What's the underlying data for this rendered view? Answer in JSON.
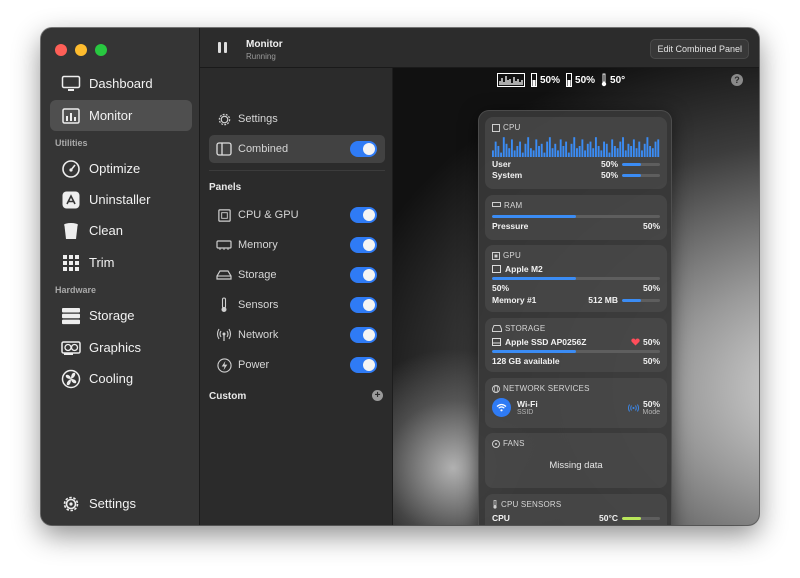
{
  "sidebar": {
    "items": [
      {
        "label": "Dashboard",
        "icon": "monitor-icon"
      },
      {
        "label": "Monitor",
        "icon": "chart-icon",
        "active": true
      }
    ],
    "utilities_label": "Utilities",
    "utilities": [
      {
        "label": "Optimize",
        "icon": "gauge-icon"
      },
      {
        "label": "Uninstaller",
        "icon": "app-store-icon"
      },
      {
        "label": "Clean",
        "icon": "trash-can-icon"
      },
      {
        "label": "Trim",
        "icon": "grid-icon"
      }
    ],
    "hardware_label": "Hardware",
    "hardware": [
      {
        "label": "Storage",
        "icon": "drive-stack-icon"
      },
      {
        "label": "Graphics",
        "icon": "gpu-card-icon"
      },
      {
        "label": "Cooling",
        "icon": "fan-icon"
      }
    ],
    "settings_label": "Settings"
  },
  "topbar": {
    "title": "Monitor",
    "status": "Running",
    "edit_button": "Edit Combined Panel"
  },
  "menu": {
    "settings": "Settings",
    "combined": "Combined",
    "panels_heading": "Panels",
    "panels": [
      {
        "label": "CPU & GPU",
        "icon": "chip-icon"
      },
      {
        "label": "Memory",
        "icon": "memory-icon"
      },
      {
        "label": "Storage",
        "icon": "drive-icon"
      },
      {
        "label": "Sensors",
        "icon": "thermometer-icon"
      },
      {
        "label": "Network",
        "icon": "antenna-icon"
      },
      {
        "label": "Power",
        "icon": "bolt-icon"
      }
    ],
    "custom_heading": "Custom"
  },
  "statusbar": {
    "mem": "50%",
    "disk": "50%",
    "temp": "50°"
  },
  "panel": {
    "cpu": {
      "title": "CPU",
      "user_label": "User",
      "user_value": "50%",
      "user_level": 0.5,
      "system_label": "System",
      "system_value": "50%",
      "system_level": 0.5,
      "graph": [
        0.3,
        0.7,
        0.5,
        0.2,
        0.9,
        0.6,
        0.4,
        0.8,
        0.3,
        0.5,
        0.7,
        0.2,
        0.6,
        0.9,
        0.4,
        0.3,
        0.8,
        0.5,
        0.6,
        0.2,
        0.7,
        0.9,
        0.4,
        0.6,
        0.3,
        0.8,
        0.5,
        0.7,
        0.2,
        0.6,
        0.9,
        0.4,
        0.5,
        0.8,
        0.3,
        0.6,
        0.7,
        0.4,
        0.9,
        0.5,
        0.3,
        0.7,
        0.6,
        0.2,
        0.8,
        0.5,
        0.4,
        0.7,
        0.9,
        0.3,
        0.6,
        0.5,
        0.8,
        0.4,
        0.7,
        0.3,
        0.6,
        0.9,
        0.5,
        0.4,
        0.7,
        0.8
      ]
    },
    "ram": {
      "title": "RAM",
      "pressure_label": "Pressure",
      "pressure_value": "50%",
      "level": 0.5
    },
    "gpu": {
      "title": "GPU",
      "name": "Apple M2",
      "val_left": "50%",
      "val_right": "50%",
      "level": 0.5,
      "mem_label": "Memory #1",
      "mem_value": "512 MB",
      "mem_level": 0.5
    },
    "storage": {
      "title": "STORAGE",
      "name": "Apple SSD AP0256Z",
      "health": "50%",
      "available": "128 GB available",
      "available_pct": "50%",
      "level": 0.5
    },
    "network": {
      "title": "NETWORK SERVICES",
      "name": "Wi-Fi",
      "sub": "SSID",
      "value": "50%",
      "mode": "Mode"
    },
    "fans": {
      "title": "FANS",
      "message": "Missing data"
    },
    "cpu_sensors": {
      "title": "CPU SENSORS",
      "label": "CPU",
      "value": "50°C",
      "level": 0.5
    }
  },
  "colors": {
    "accent": "#2f7bf5",
    "bar": "#3b8cf4",
    "health": "#ff4d5a",
    "sensor": "#b9e65a"
  }
}
